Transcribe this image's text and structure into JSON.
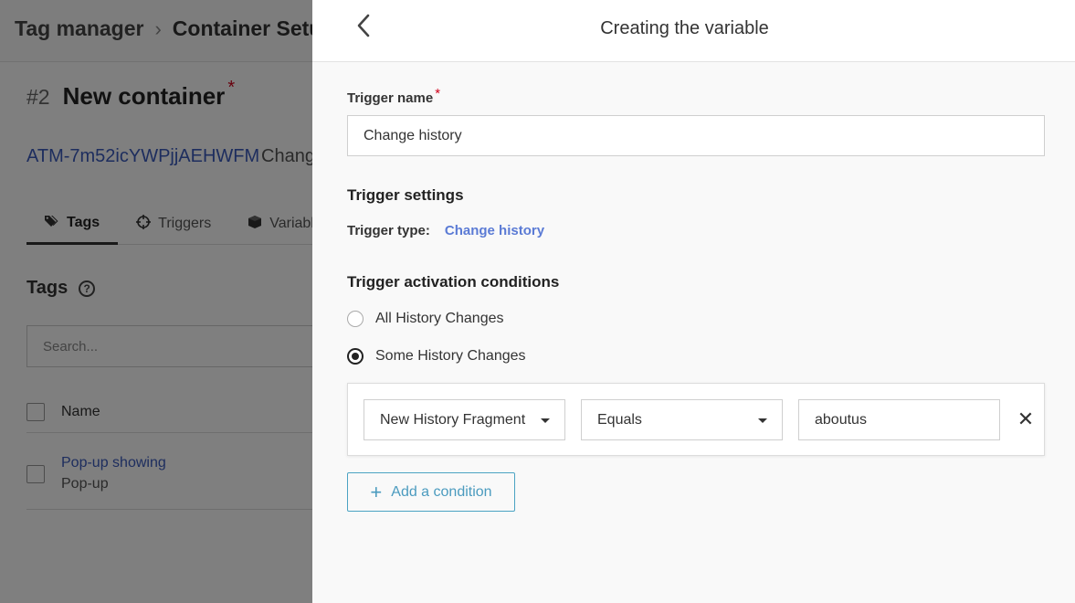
{
  "background": {
    "breadcrumb": {
      "root": "Tag manager",
      "separator": "›",
      "current": "Container Setu"
    },
    "container": {
      "number": "#2",
      "name": "New container",
      "required_mark": "*",
      "id": "ATM-7m52icYWPjjAEHWFM",
      "change": "Chang"
    },
    "tabs": [
      {
        "label": "Tags",
        "icon": "tags-icon",
        "active": true
      },
      {
        "label": "Triggers",
        "icon": "crosshair-icon",
        "active": false
      },
      {
        "label": "Variabl",
        "icon": "cube-icon",
        "active": false
      }
    ],
    "section": {
      "title": "Tags",
      "help_icon": "help-circle-icon"
    },
    "search": {
      "placeholder": "Search..."
    },
    "table": {
      "columns": [
        "Name"
      ],
      "rows": [
        {
          "title": "Pop-up showing",
          "subtitle": "Pop-up"
        }
      ]
    }
  },
  "panel": {
    "title": "Creating the variable",
    "back_icon": "chevron-left-icon",
    "trigger_name": {
      "label": "Trigger name",
      "required_mark": "*",
      "value": "Change history"
    },
    "settings_title": "Trigger settings",
    "trigger_type": {
      "label": "Trigger type:",
      "value": "Change history"
    },
    "conditions_title": "Trigger activation conditions",
    "options": [
      {
        "label": "All History Changes",
        "checked": false
      },
      {
        "label": "Some History Changes",
        "checked": true
      }
    ],
    "condition": {
      "field": "New History Fragment",
      "operator": "Equals",
      "value": "aboutus",
      "remove_icon": "close-icon",
      "remove_symbol": "✕"
    },
    "add_button": {
      "label": "Add a condition",
      "icon": "plus-icon",
      "symbol": "+"
    }
  },
  "colors": {
    "accent": "#5b7bd5",
    "link": "#3b5bbd",
    "add_button": "#4b9bbf",
    "required": "#d0021b"
  }
}
